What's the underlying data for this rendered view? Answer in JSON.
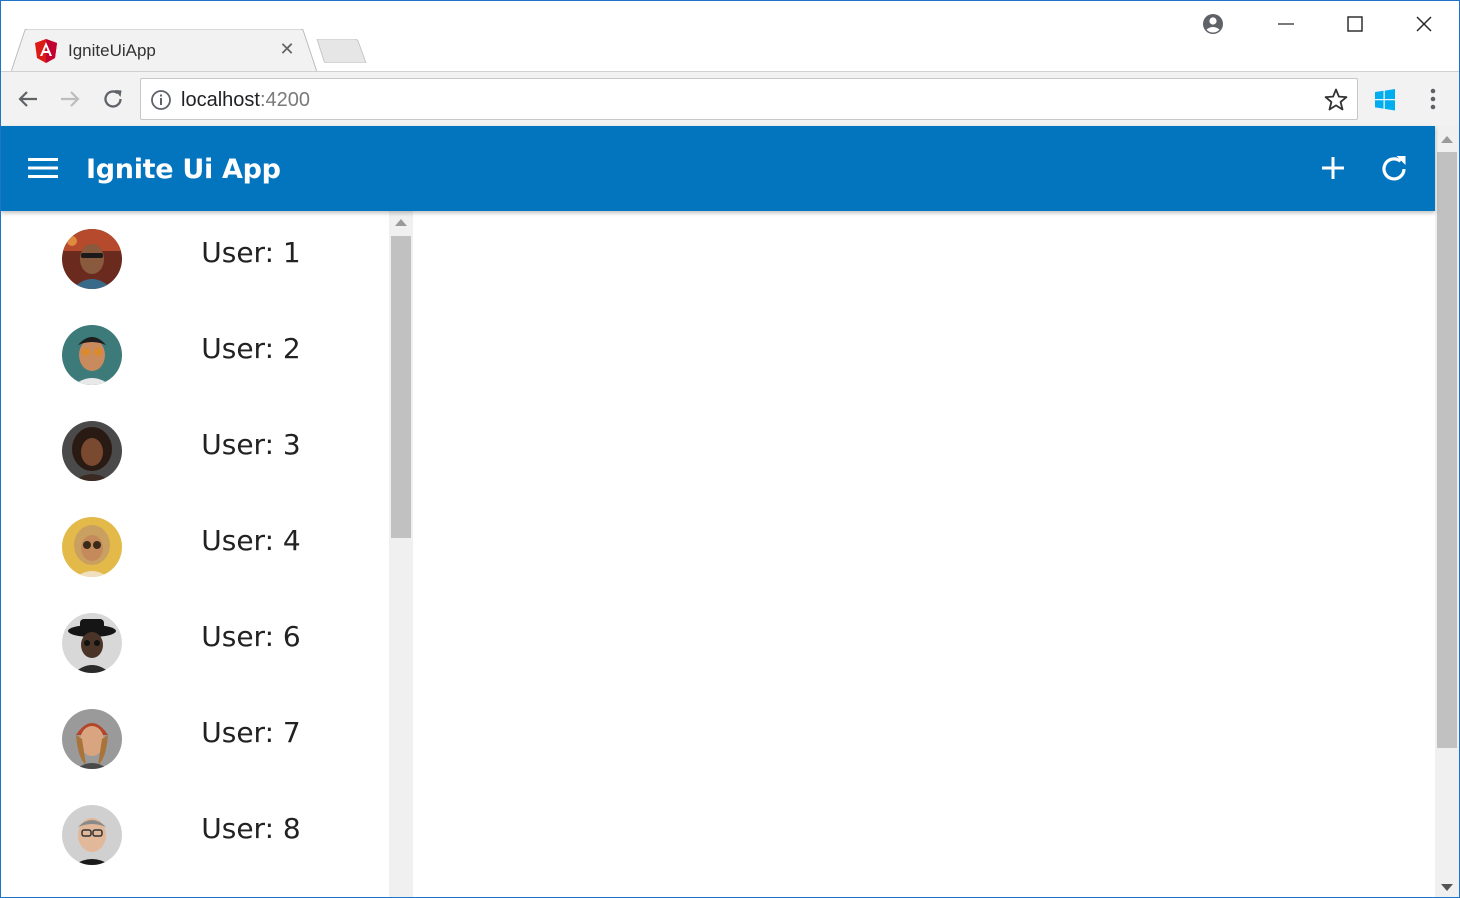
{
  "browser": {
    "tab": {
      "title": "IgniteUiApp",
      "favicon": "angular-icon",
      "close_glyph": "✕"
    },
    "address": {
      "host": "localhost",
      "port": ":4200"
    },
    "icons": [
      "profile-icon",
      "minimize-icon",
      "maximize-icon",
      "close-icon",
      "back-arrow-icon",
      "forward-arrow-icon",
      "reload-icon",
      "info-icon",
      "star-icon",
      "windows-extension-icon",
      "kebab-menu-icon"
    ]
  },
  "app": {
    "title": "Ignite Ui App",
    "brand_color": "#0375be",
    "actions": [
      "add-icon",
      "refresh-icon"
    ]
  },
  "users": [
    {
      "label": "User: 1",
      "avatar": "avatar-1"
    },
    {
      "label": "User: 2",
      "avatar": "avatar-2"
    },
    {
      "label": "User: 3",
      "avatar": "avatar-3"
    },
    {
      "label": "User: 4",
      "avatar": "avatar-4"
    },
    {
      "label": "User: 6",
      "avatar": "avatar-6"
    },
    {
      "label": "User: 7",
      "avatar": "avatar-7"
    },
    {
      "label": "User: 8",
      "avatar": "avatar-8"
    }
  ]
}
